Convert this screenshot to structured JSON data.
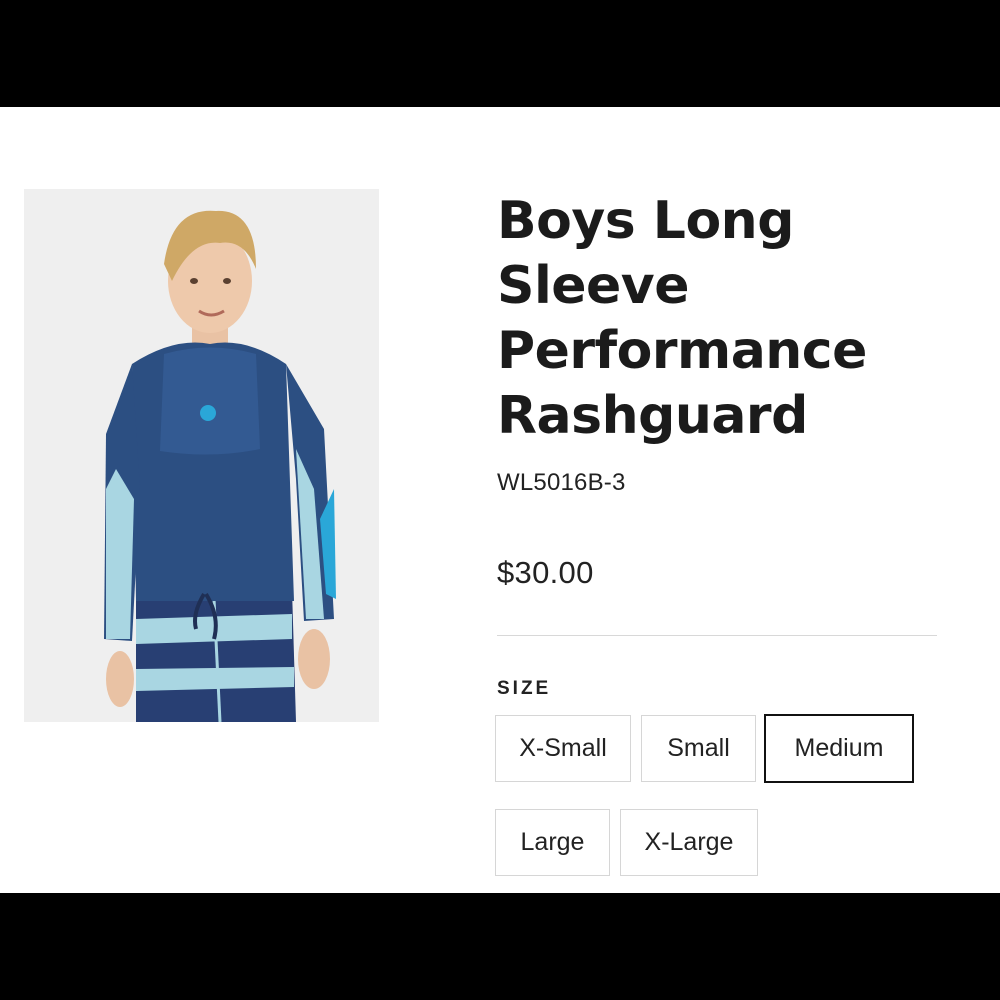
{
  "product": {
    "title_lines": [
      "Boys Long",
      "Sleeve",
      "Performance",
      "Rashguard"
    ],
    "sku": "WL5016B-3",
    "price": "$30.00",
    "image_alt": "boy-wearing-rashguard"
  },
  "size_selector": {
    "label": "SIZE",
    "options": [
      "X-Small",
      "Small",
      "Medium",
      "Large",
      "X-Large"
    ],
    "selected": "Medium"
  },
  "colors": {
    "shirt": "#2c4f82",
    "shirt_side": "#a9d6e2",
    "accent": "#2aa7d8",
    "shorts_dark": "#283f73"
  }
}
